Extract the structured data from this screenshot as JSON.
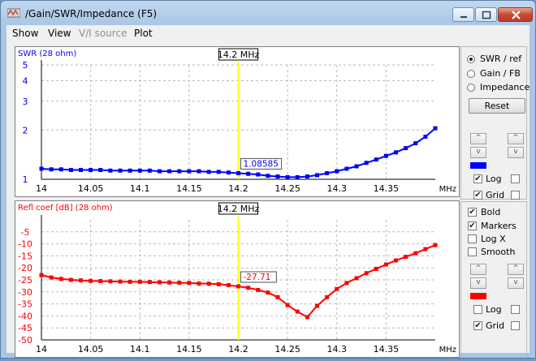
{
  "window": {
    "title": "/Gain/SWR/Impedance (F5)"
  },
  "menu": [
    "Show",
    "View",
    "V/I source",
    "Plot"
  ],
  "menu_disabled": [
    false,
    false,
    true,
    false
  ],
  "top_panel": {
    "options": [
      "SWR / ref",
      "Gain / FB",
      "Impedance"
    ],
    "selected": 0,
    "reset_label": "Reset",
    "up_label": "^",
    "down_label": "v",
    "color": "#0000ff",
    "log": {
      "label": "Log",
      "checked": true
    },
    "grid": {
      "label": "Grid",
      "checked": true
    }
  },
  "bottom_panel": {
    "bold": {
      "label": "Bold",
      "checked": true
    },
    "markers": {
      "label": "Markers",
      "checked": true
    },
    "logx": {
      "label": "Log X",
      "checked": false
    },
    "smooth": {
      "label": "Smooth",
      "checked": false
    },
    "up_label": "^",
    "down_label": "v",
    "color": "#ff0000",
    "log": {
      "label": "Log",
      "checked": false
    },
    "grid": {
      "label": "Grid",
      "checked": true
    }
  },
  "chart_data": [
    {
      "type": "line",
      "title": "SWR (28 ohm)",
      "color": "#0000ff",
      "xlabel": "MHz",
      "x_ticks": [
        "14",
        "14.05",
        "14.1",
        "14.15",
        "14.2",
        "14.25",
        "14.3",
        "14.35"
      ],
      "xlim": [
        14.0,
        14.4
      ],
      "y_scale": "log",
      "y_ticks": [
        "1",
        "2",
        "3",
        "4",
        "5"
      ],
      "ylim": [
        1,
        5
      ],
      "cursor": {
        "x": 14.2,
        "label": "14.2 MHz",
        "value_label": "1.08585"
      },
      "x": [
        14.0,
        14.01,
        14.02,
        14.03,
        14.04,
        14.05,
        14.06,
        14.07,
        14.08,
        14.09,
        14.1,
        14.11,
        14.12,
        14.13,
        14.14,
        14.15,
        14.16,
        14.17,
        14.18,
        14.19,
        14.2,
        14.21,
        14.22,
        14.23,
        14.24,
        14.25,
        14.26,
        14.27,
        14.28,
        14.29,
        14.3,
        14.31,
        14.32,
        14.33,
        14.34,
        14.35,
        14.36,
        14.37,
        14.38,
        14.39,
        14.4
      ],
      "values": [
        1.16,
        1.15,
        1.15,
        1.14,
        1.14,
        1.14,
        1.14,
        1.13,
        1.13,
        1.13,
        1.13,
        1.13,
        1.12,
        1.12,
        1.12,
        1.12,
        1.12,
        1.11,
        1.11,
        1.1,
        1.09,
        1.08,
        1.07,
        1.05,
        1.04,
        1.03,
        1.03,
        1.04,
        1.06,
        1.09,
        1.12,
        1.16,
        1.2,
        1.26,
        1.32,
        1.39,
        1.46,
        1.55,
        1.66,
        1.82,
        2.05
      ]
    },
    {
      "type": "line",
      "title": "Refl coef [dB] (28 ohm)",
      "color": "#ff0000",
      "xlabel": "MHz",
      "x_ticks": [
        "14",
        "14.05",
        "14.1",
        "14.15",
        "14.2",
        "14.25",
        "14.3",
        "14.35"
      ],
      "xlim": [
        14.0,
        14.4
      ],
      "y_ticks": [
        "-5",
        "-10",
        "-15",
        "-20",
        "-25",
        "-30",
        "-35",
        "-40",
        "-45",
        "-50"
      ],
      "ylim": [
        -50,
        0
      ],
      "cursor": {
        "x": 14.2,
        "label": "14.2 MHz",
        "value_label": "-27.71"
      },
      "x": [
        14.0,
        14.01,
        14.02,
        14.03,
        14.04,
        14.05,
        14.06,
        14.07,
        14.08,
        14.09,
        14.1,
        14.11,
        14.12,
        14.13,
        14.14,
        14.15,
        14.16,
        14.17,
        14.18,
        14.19,
        14.2,
        14.21,
        14.22,
        14.23,
        14.24,
        14.25,
        14.26,
        14.27,
        14.28,
        14.29,
        14.3,
        14.31,
        14.32,
        14.33,
        14.34,
        14.35,
        14.36,
        14.37,
        14.38,
        14.39,
        14.4
      ],
      "values": [
        -23.0,
        -24.0,
        -24.6,
        -25.0,
        -25.2,
        -25.4,
        -25.5,
        -25.6,
        -25.7,
        -25.8,
        -25.8,
        -25.9,
        -26.0,
        -26.1,
        -26.2,
        -26.3,
        -26.5,
        -26.6,
        -26.8,
        -27.2,
        -27.7,
        -28.3,
        -29.2,
        -30.3,
        -32.2,
        -35.5,
        -38.2,
        -40.5,
        -35.8,
        -32.2,
        -28.8,
        -26.3,
        -24.3,
        -22.2,
        -20.4,
        -18.6,
        -16.9,
        -15.4,
        -13.9,
        -12.2,
        -10.5
      ]
    }
  ]
}
